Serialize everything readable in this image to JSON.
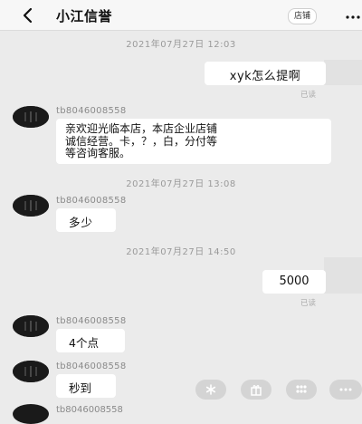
{
  "header": {
    "title": "小江信誉",
    "shop_label": "店铺",
    "back_icon": "chevron-left-icon",
    "more_icon": "ellipsis-icon"
  },
  "messages": [
    {
      "type": "time",
      "text": "2021年07月27日 12:03"
    },
    {
      "type": "out",
      "text": "xyk怎么提啊",
      "status": "已读"
    },
    {
      "type": "in",
      "nick": "tb8046008558",
      "lines": [
        "亲欢迎光临本店，本店企业店铺",
        "诚信经营。卡，？，白，分付等",
        "等咨询客服。"
      ]
    },
    {
      "type": "time",
      "text": "2021年07月27日 13:08"
    },
    {
      "type": "in",
      "nick": "tb8046008558",
      "lines": [
        "多少"
      ]
    },
    {
      "type": "time",
      "text": "2021年07月27日 14:50"
    },
    {
      "type": "out",
      "text": "5000",
      "status": "已读"
    },
    {
      "type": "in",
      "nick": "tb8046008558",
      "lines": [
        "4个点"
      ]
    },
    {
      "type": "in",
      "nick": "tb8046008558",
      "lines": [
        "秒到"
      ]
    },
    {
      "type": "in",
      "nick": "tb8046008558",
      "lines": []
    }
  ],
  "quick_actions": [
    {
      "icon": "asterisk-icon"
    },
    {
      "icon": "gift-icon"
    },
    {
      "icon": "grid-icon"
    },
    {
      "icon": "more-dots-icon"
    }
  ],
  "colors": {
    "background": "#ebebeb",
    "bubble": "#ffffff",
    "timestamp": "#9a9a9a",
    "avatar": "#1a1a1a"
  }
}
